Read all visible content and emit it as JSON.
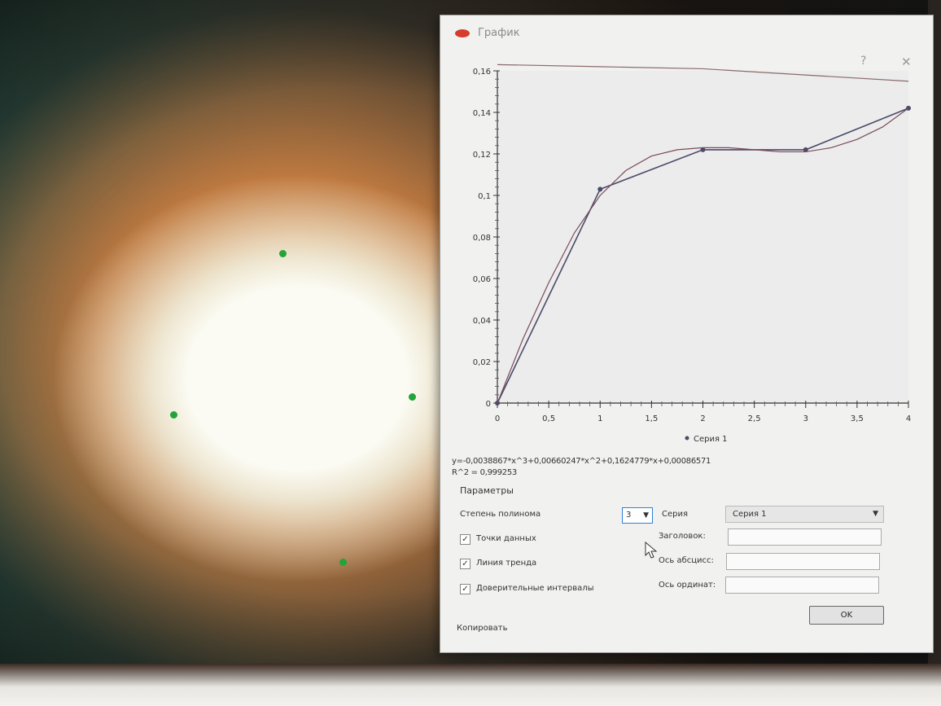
{
  "dialog": {
    "title": "График",
    "help_label": "?",
    "close_label": "✕",
    "icon": "app-icon",
    "equation": "y=-0,0038867*x^3+0,00660247*x^2+0,1624779*x+0,00086571",
    "r_squared": "R^2 = 0,999253",
    "parameters_title": "Параметры",
    "degree_label": "Степень полинома",
    "degree_value": "3",
    "series_label": "Серия",
    "series_value": "Серия 1",
    "checkboxes": [
      {
        "label": "Точки данных",
        "checked": true
      },
      {
        "label": "Линия тренда",
        "checked": true
      },
      {
        "label": "Доверительные интервалы",
        "checked": true
      }
    ],
    "title_field_label": "Заголовок:",
    "x_axis_field_label": "Ось абсцисс:",
    "y_axis_field_label": "Ось ординат:",
    "title_field_value": "",
    "x_axis_field_value": "",
    "y_axis_field_value": "",
    "ok_label": "OK",
    "copy_label": "Копировать"
  },
  "chart_data": {
    "type": "line",
    "x_ticks": [
      "0",
      "0,5",
      "1",
      "1,5",
      "2",
      "2,5",
      "3",
      "3,5",
      "4"
    ],
    "y_ticks": [
      "0",
      "0,02",
      "0,04",
      "0,06",
      "0,08",
      "0,1",
      "0,12",
      "0,14",
      "0,16"
    ],
    "xlim": [
      0,
      4
    ],
    "ylim": [
      0,
      0.16
    ],
    "legend": "Серия 1",
    "legend_position": "bottom",
    "series": [
      {
        "name": "Серия 1",
        "kind": "data",
        "color": "#4a4a6a",
        "x": [
          0,
          1,
          2,
          3,
          4
        ],
        "y": [
          0,
          0.103,
          0.122,
          0.122,
          0.142
        ]
      },
      {
        "kind": "trend",
        "color": "#7a4a5a",
        "x": [
          0,
          0.25,
          0.5,
          0.75,
          1,
          1.25,
          1.5,
          1.75,
          2,
          2.25,
          2.5,
          2.75,
          3,
          3.25,
          3.5,
          3.75,
          4
        ],
        "y": [
          0,
          0.031,
          0.058,
          0.082,
          0.1,
          0.112,
          0.119,
          0.122,
          0.123,
          0.123,
          0.122,
          0.121,
          0.121,
          0.123,
          0.127,
          0.133,
          0.142
        ]
      },
      {
        "kind": "confidence",
        "color": "#8a6a6a",
        "x": [
          0,
          1,
          2,
          3,
          4
        ],
        "y": [
          0.163,
          0.162,
          0.161,
          0.158,
          0.155
        ]
      }
    ]
  },
  "screen_markers": {
    "color": "#23a43a",
    "count": 4
  }
}
